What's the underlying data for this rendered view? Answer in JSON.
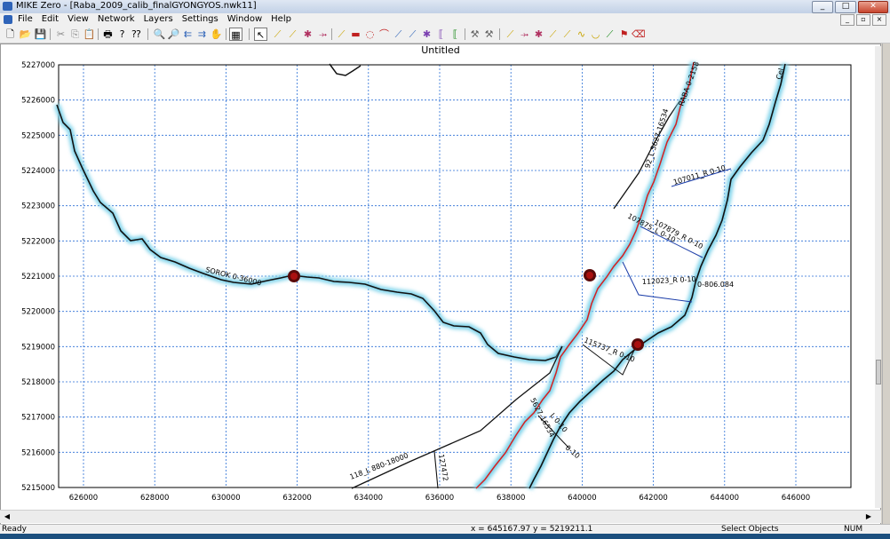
{
  "window": {
    "title": "MIKE Zero - [Raba_2009_calib_finalGYONGYOS.nwk11]",
    "minimize": "_",
    "maximize": "□",
    "close": "✕"
  },
  "menu": [
    "File",
    "Edit",
    "View",
    "Network",
    "Layers",
    "Settings",
    "Window",
    "Help"
  ],
  "mdi_controls": [
    "_",
    "▫",
    "×"
  ],
  "document": {
    "title": "Untitled"
  },
  "axes": {
    "y_ticks": [
      "5227000",
      "5226000",
      "5225000",
      "5224000",
      "5223000",
      "5222000",
      "5221000",
      "5220000",
      "5219000",
      "5218000",
      "5217000",
      "5216000",
      "5215000"
    ],
    "x_ticks": [
      "626000",
      "628000",
      "630000",
      "632000",
      "634000",
      "636000",
      "638000",
      "640000",
      "642000",
      "644000",
      "646000"
    ]
  },
  "river_labels": [
    "SOROK 0-36000",
    "RABA 0-2158",
    "92_L 5627-16534",
    "107011_R 0-10",
    "107875_L 0-10",
    "107879_R 0-10",
    "112023_R 0-10",
    "0-806.084",
    "115737_R 0-10",
    "118_L 880-18000",
    "127472",
    "Cel",
    "L 0-10",
    "0-10",
    "5627-16534"
  ],
  "status": {
    "left": "Ready",
    "coords": "x = 645167.97  y = 5219211.1",
    "mode": "Select Objects",
    "num": "NUM"
  },
  "colors": {
    "grid": "#2a6fd6",
    "river": "#111111",
    "halo": "#7fd3ea",
    "calib_river": "#d62020",
    "branch_link": "#1a3ca8",
    "node": "#5a0a0a"
  },
  "toolbar_icons": [
    "new",
    "open",
    "save",
    "cut",
    "copy",
    "paste",
    "print",
    "about",
    "help-arrow",
    "zoom-in",
    "zoom-out",
    "pan-back",
    "pan-forward",
    "pan-hand",
    "grid-select",
    "select-arrow",
    "branch-tools"
  ]
}
